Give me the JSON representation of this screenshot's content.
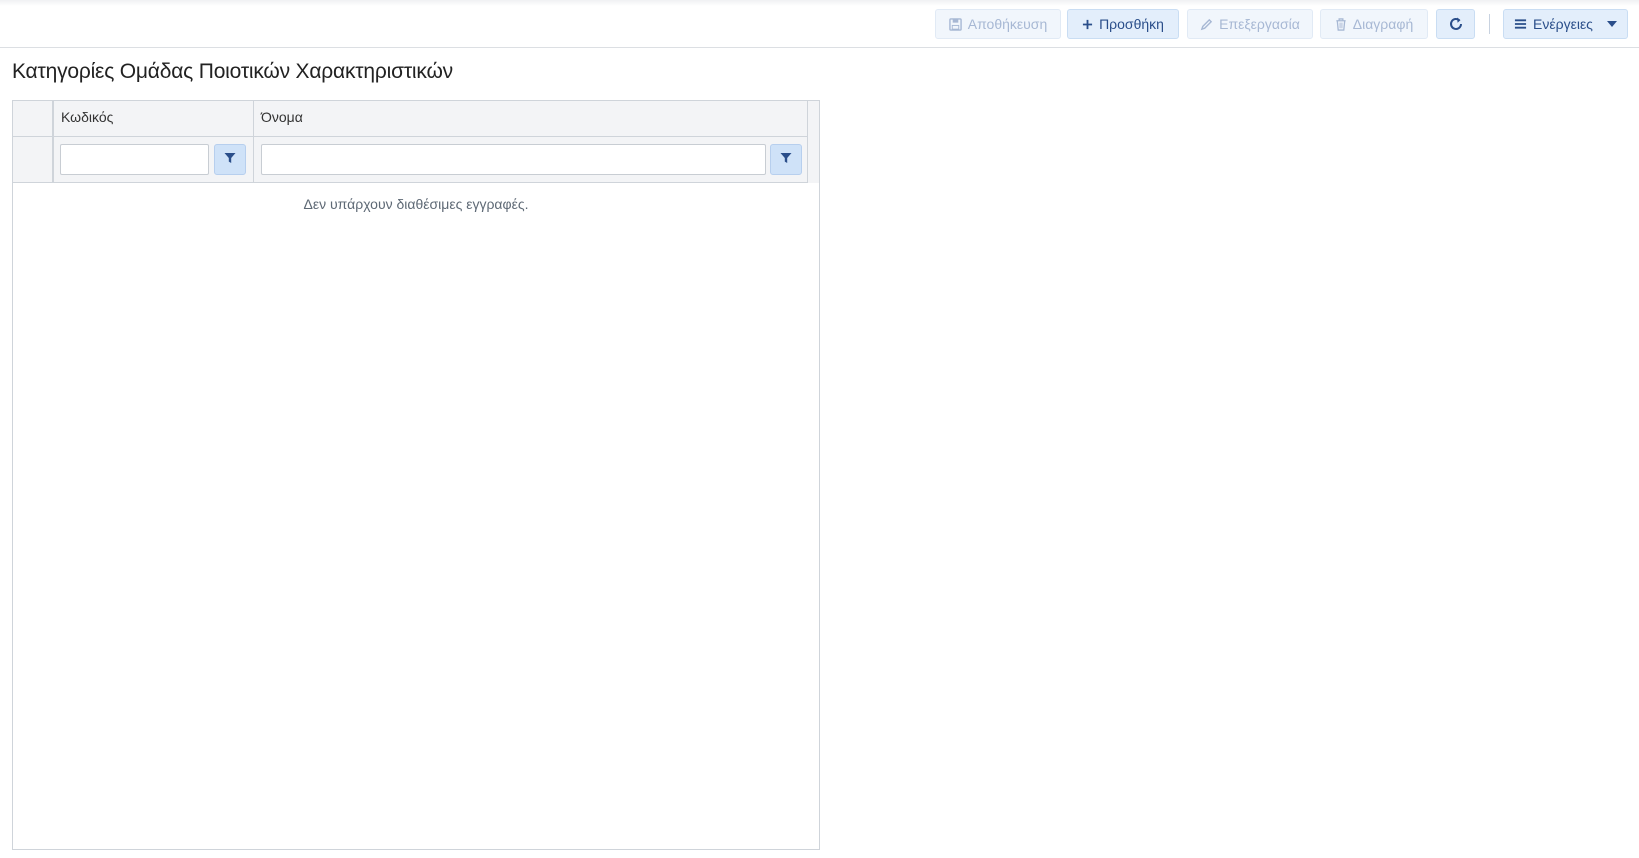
{
  "toolbar": {
    "save_label": "Αποθήκευση",
    "add_label": "Προσθήκη",
    "edit_label": "Επεξεργασία",
    "delete_label": "Διαγραφή",
    "actions_label": "Ενέργειες",
    "save_enabled": false,
    "add_enabled": true,
    "edit_enabled": false,
    "delete_enabled": false,
    "refresh_enabled": true,
    "actions_enabled": true,
    "accent_color": "#2a4e8a",
    "button_bg": "#e3eefb"
  },
  "page": {
    "title": "Κατηγορίες Ομάδας Ποιοτικών Χαρακτηριστικών"
  },
  "grid": {
    "columns": [
      {
        "label": "Κωδικός",
        "filter_value": "",
        "filter_icon": "filter-icon"
      },
      {
        "label": "Όνομα",
        "filter_value": "",
        "filter_icon": "filter-icon"
      }
    ],
    "rows": [],
    "empty_message": "Δεν υπάρχουν διαθέσιμες εγγραφές."
  },
  "icons": {
    "save": "floppy-disk-icon",
    "add": "plus-icon",
    "edit": "pencil-icon",
    "delete": "trash-icon",
    "refresh": "refresh-icon",
    "actions_menu": "bars-icon",
    "actions_caret": "caret-down-icon",
    "filter": "filter-icon"
  }
}
